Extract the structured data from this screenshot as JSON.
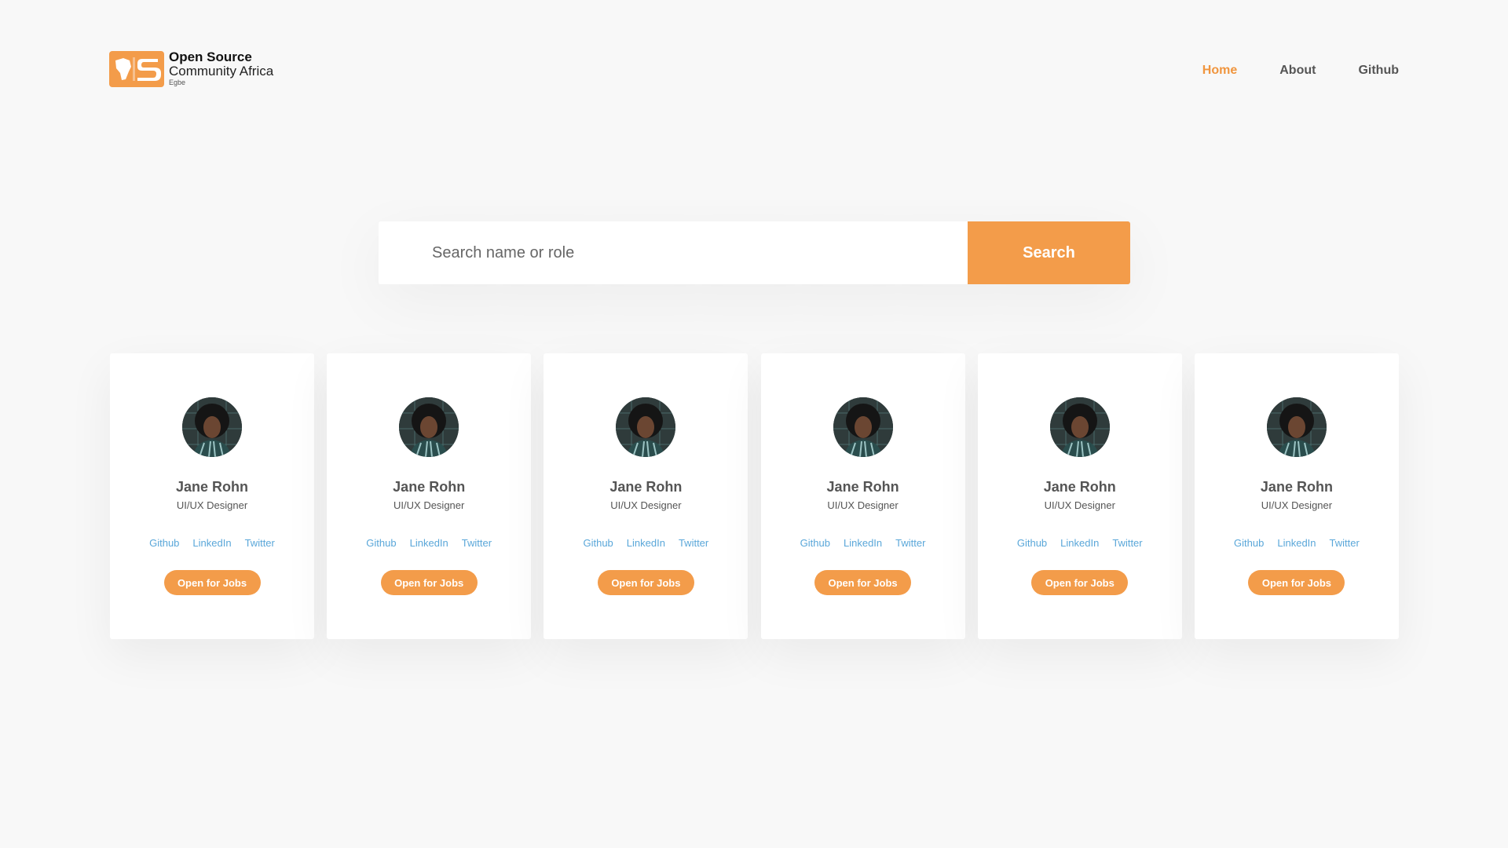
{
  "brand": {
    "line1": "Open Source",
    "line2": "Community Africa",
    "line3": "Egbe",
    "accent_color": "#f39c4a",
    "logo_icon": "africa-os-logo-icon"
  },
  "nav": {
    "items": [
      {
        "label": "Home",
        "active": true
      },
      {
        "label": "About",
        "active": false
      },
      {
        "label": "Github",
        "active": false
      }
    ]
  },
  "search": {
    "placeholder": "Search name or role",
    "value": "",
    "button_label": "Search"
  },
  "cards": [
    {
      "name": "Jane Rohn",
      "role": "UI/UX Designer",
      "links": [
        "Github",
        "LinkedIn",
        "Twitter"
      ],
      "button": "Open for Jobs",
      "avatar_icon": "profile-photo"
    },
    {
      "name": "Jane Rohn",
      "role": "UI/UX Designer",
      "links": [
        "Github",
        "LinkedIn",
        "Twitter"
      ],
      "button": "Open for Jobs",
      "avatar_icon": "profile-photo"
    },
    {
      "name": "Jane Rohn",
      "role": "UI/UX Designer",
      "links": [
        "Github",
        "LinkedIn",
        "Twitter"
      ],
      "button": "Open for Jobs",
      "avatar_icon": "profile-photo"
    },
    {
      "name": "Jane Rohn",
      "role": "UI/UX Designer",
      "links": [
        "Github",
        "LinkedIn",
        "Twitter"
      ],
      "button": "Open for Jobs",
      "avatar_icon": "profile-photo"
    },
    {
      "name": "Jane Rohn",
      "role": "UI/UX Designer",
      "links": [
        "Github",
        "LinkedIn",
        "Twitter"
      ],
      "button": "Open for Jobs",
      "avatar_icon": "profile-photo"
    },
    {
      "name": "Jane Rohn",
      "role": "UI/UX Designer",
      "links": [
        "Github",
        "LinkedIn",
        "Twitter"
      ],
      "button": "Open for Jobs",
      "avatar_icon": "profile-photo"
    }
  ],
  "colors": {
    "background": "#f8f8f8",
    "accent": "#f39c4a",
    "link": "#5aa7d9",
    "text": "#555555"
  }
}
